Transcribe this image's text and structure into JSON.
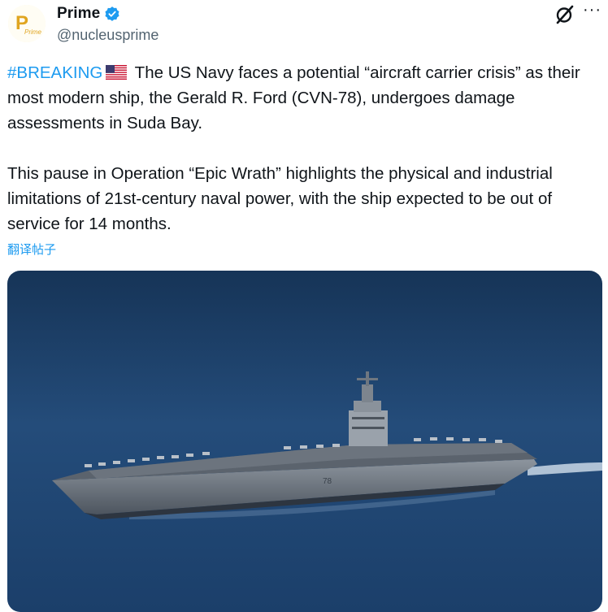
{
  "author": {
    "display_name": "Prime",
    "handle": "@nucleusprime",
    "avatar_text": "Prime",
    "avatar_letter": "P",
    "verified": true
  },
  "actions": {
    "grok_icon": "grok-slash-icon",
    "more_label": "···"
  },
  "tweet": {
    "hashtag": "#BREAKING",
    "flag_icon": "us-flag-icon",
    "paragraph1_rest": " The US Navy faces a potential “aircraft carrier crisis” as their most modern ship, the Gerald R. Ford (CVN-78), undergoes damage assessments in Suda Bay.",
    "paragraph2": "This pause in Operation “Epic Wrath” highlights the physical and industrial limitations of 21st-century naval power, with the ship expected to be out of service for 14 months.",
    "translate_label": "翻译帖子"
  },
  "media": {
    "subject": "aircraft carrier at sea"
  },
  "colors": {
    "accent": "#1d9bf0",
    "text": "#0f1419",
    "secondary": "#536471",
    "sea_dark": "#0f2a4a",
    "sea_light": "#2f5f91"
  }
}
